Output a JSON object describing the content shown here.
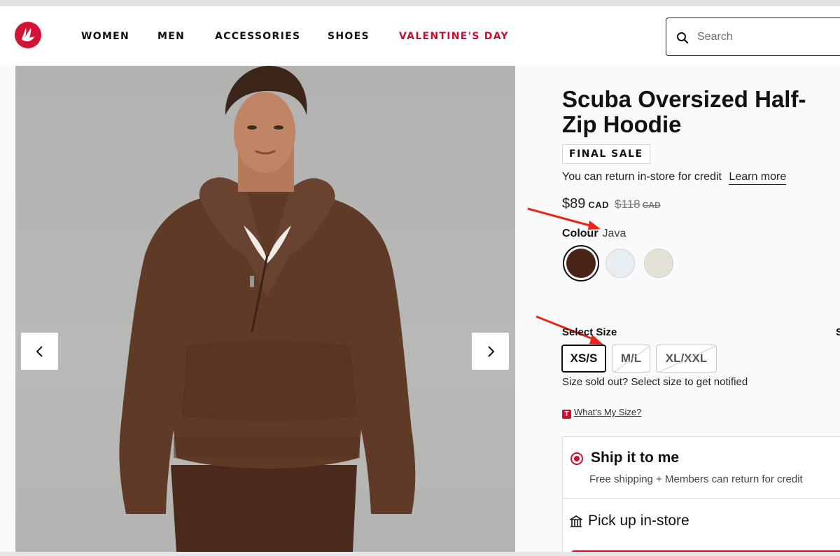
{
  "header": {
    "nav": [
      {
        "label": "WOMEN"
      },
      {
        "label": "MEN"
      },
      {
        "label": "ACCESSORIES"
      },
      {
        "label": "SHOES"
      },
      {
        "label": "VALENTINE'S DAY"
      }
    ],
    "search_placeholder": "Search",
    "accent_color": "#c8102e"
  },
  "product": {
    "title": "Scuba Oversized Half-Zip Hoodie",
    "badge": "FINAL SALE",
    "return_text": "You can return in-store for credit",
    "return_link": "Learn more",
    "price_now": "$89",
    "price_now_currency": "CAD",
    "price_was": "$118",
    "price_was_currency": "CAD",
    "colour_label": "Colour",
    "colour_value": "Java",
    "swatches": [
      {
        "name": "Java",
        "color": "#4a2418",
        "selected": true
      },
      {
        "name": "light-blue",
        "color": "#e6eef3",
        "selected": false
      },
      {
        "name": "light-cream",
        "color": "#e4e1d7",
        "selected": false
      }
    ],
    "size_title": "Select Size",
    "size_side_text": "S",
    "sizes": [
      {
        "label": "XS/S",
        "selected": true,
        "sold_out": false
      },
      {
        "label": "M/L",
        "selected": false,
        "sold_out": true
      },
      {
        "label": "XL/XXL",
        "selected": false,
        "sold_out": true
      }
    ],
    "sold_out_text": "Size sold out? Select size to get notified",
    "whats_my_size_icon": "T",
    "whats_my_size": "What's My Size?"
  },
  "fulfillment": {
    "ship_title": "Ship it to me",
    "ship_sub": "Free shipping + Members can return for credit",
    "pickup_title": "Pick up in-store"
  }
}
